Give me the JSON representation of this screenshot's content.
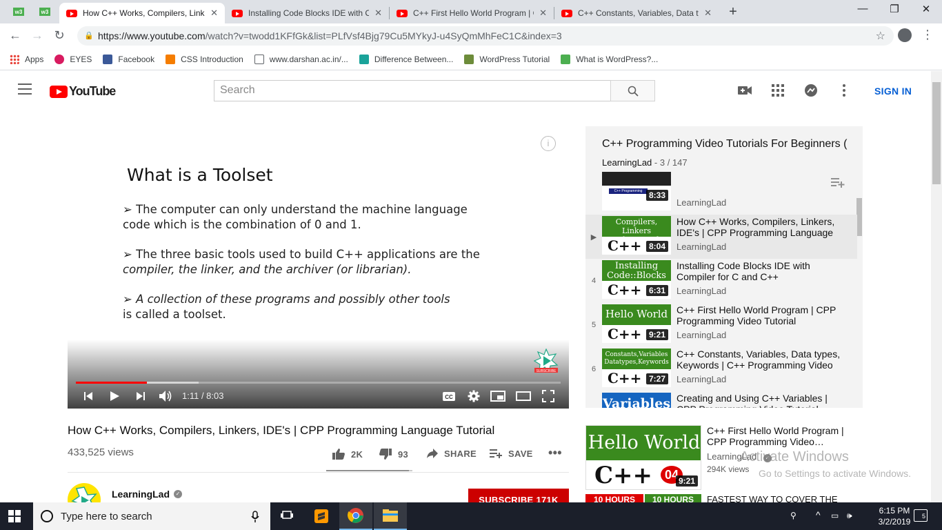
{
  "browser": {
    "tabs": [
      {
        "title": "How C++ Works, Compilers, Linkers, IDE's | CPP Programming Language Tutorial - YouTube",
        "active": true
      },
      {
        "title": "Installing Code Blocks IDE with Compiler for C and C++",
        "active": false
      },
      {
        "title": "C++ First Hello World Program | CPP Programming Video Tutorial",
        "active": false
      },
      {
        "title": "C++ Constants, Variables, Data types, Keywords",
        "active": false
      }
    ],
    "mini_tabs": [
      "w3",
      "w3"
    ],
    "url_host": "https://www.youtube.com",
    "url_path": "/watch?v=twodd1KFfGk&list=PLfVsf4Bjg79Cu5MYkyJ-u4SyQmMhFeC1C&index=3",
    "bookmarks": [
      {
        "label": "Apps",
        "icon": "apps-grid-icon",
        "color": "#e8453c"
      },
      {
        "label": "EYES",
        "icon": "eyes-circle-icon",
        "color": "#d81b60"
      },
      {
        "label": "Facebook",
        "icon": "facebook-icon",
        "color": "#3b5998"
      },
      {
        "label": "CSS Introduction",
        "icon": "blogger-icon",
        "color": "#f57d00"
      },
      {
        "label": "www.darshan.ac.in/...",
        "icon": "page-icon",
        "color": "#ffffff"
      },
      {
        "label": "Difference Between...",
        "icon": "hexagon-icon",
        "color": "#1aa39a"
      },
      {
        "label": "WordPress Tutorial",
        "icon": "tutorial-icon",
        "color": "#6d8c3a"
      },
      {
        "label": "What is WordPress?...",
        "icon": "info-icon",
        "color": "#4caf50"
      }
    ]
  },
  "youtube": {
    "logo_text": "YouTube",
    "search_placeholder": "Search",
    "signin_label": "SIGN IN"
  },
  "player": {
    "slide": {
      "title": "What is a Toolset",
      "p1": "➢ The computer can only understand the machine language code which is the combination of 0 and 1.",
      "p2_a": "➢ The three basic tools used to build C++ applications are the ",
      "p2_b": "compiler, the linker, and the archiver (or librarian).",
      "p3_a": "➢  A collection of these programs and possibly other tools",
      "p3_b": "is called a toolset."
    },
    "current_time": "1:11",
    "duration": "8:03",
    "time_text": "1:11 / 8:03",
    "progress_fraction": 0.147,
    "buffer_fraction": 0.253,
    "watermark_label": "SUBSCRIBE"
  },
  "video": {
    "title": "How C++ Works, Compilers, Linkers, IDE's | CPP Programming Language Tutorial",
    "views": "433,525 views",
    "likes": "2K",
    "dislikes": "93",
    "like_fraction": 0.956,
    "share_label": "SHARE",
    "save_label": "SAVE",
    "channel": "LearningLad",
    "subscribe_label": "SUBSCRIBE  171K"
  },
  "playlist": {
    "title": "C++ Programming Video Tutorials For Beginners (",
    "owner": "LearningLad",
    "position": "- 3 / 147",
    "items": [
      {
        "index": "",
        "thumb_top": "",
        "duration": "8:33",
        "title": "",
        "channel": "LearningLad"
      },
      {
        "index": "▶",
        "thumb_top": "Compilers, Linkers Archivers, Ide",
        "duration": "8:04",
        "title": "How C++ Works, Compilers, Linkers, IDE's | CPP Programming Language",
        "channel": "LearningLad"
      },
      {
        "index": "4",
        "thumb_top": "Installing Code::Blocks",
        "duration": "6:31",
        "title": "Installing Code Blocks IDE with Compiler for C and C++",
        "channel": "LearningLad"
      },
      {
        "index": "5",
        "thumb_top": "Hello World",
        "duration": "9:21",
        "title": "C++ First Hello World Program | CPP Programming Video Tutorial",
        "channel": "LearningLad"
      },
      {
        "index": "6",
        "thumb_top": "Constants,Variables Datatypes,Keywords",
        "duration": "7:27",
        "title": "C++ Constants, Variables, Data types, Keywords | C++ Programming Video",
        "channel": "LearningLad"
      },
      {
        "index": "",
        "thumb_top": "Variables",
        "duration": "",
        "title": "Creating and Using C++ Variables | CPP Programming Video Tutorial",
        "channel": ""
      }
    ],
    "thumb_bottom": "C++"
  },
  "recommendation": {
    "thumb_top": "Hello World",
    "thumb_bottom": "C++",
    "thumb_badge": "04",
    "duration": "9:21",
    "title": "C++ First Hello World Program | CPP Programming Video…",
    "channel": "LearningLad",
    "views": "294K views"
  },
  "next_strip": {
    "a": "10 HOURS",
    "b": "10 HOURS",
    "title": "FASTEST WAY TO COVER THE"
  },
  "activation": {
    "line1": "Activate Windows",
    "line2": "Go to Settings to activate Windows."
  },
  "taskbar": {
    "search_placeholder": "Type here to search",
    "time": "6:15 PM",
    "date": "3/2/2019",
    "notifications": "5"
  }
}
